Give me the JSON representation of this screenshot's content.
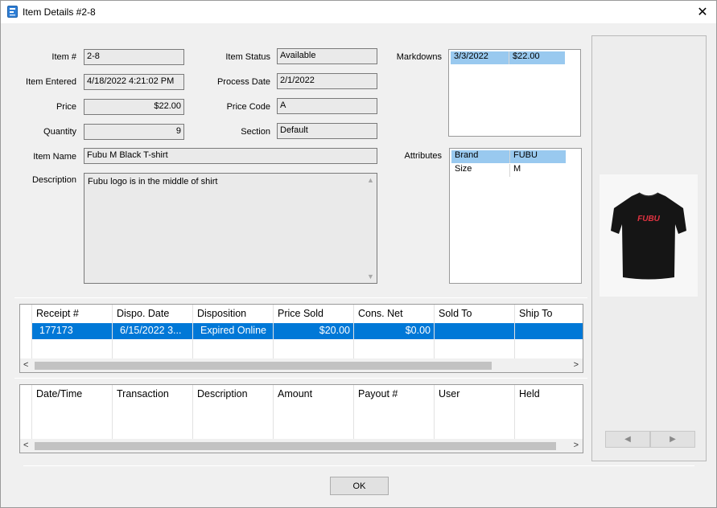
{
  "window": {
    "title": "Item Details #2-8",
    "close_label": "✕"
  },
  "item": {
    "labels": {
      "item_no": "Item #",
      "item_entered": "Item Entered",
      "price": "Price",
      "quantity": "Quantity",
      "item_status": "Item Status",
      "process_date": "Process Date",
      "price_code": "Price Code",
      "section": "Section",
      "item_name": "Item Name",
      "description": "Description",
      "markdowns": "Markdowns",
      "attributes": "Attributes"
    },
    "values": {
      "item_no": "2-8",
      "item_entered": "4/18/2022 4:21:02 PM",
      "price": "$22.00",
      "quantity": "9",
      "item_status": "Available",
      "process_date": "2/1/2022",
      "price_code": "A",
      "section": "Default",
      "item_name": "Fubu M Black T-shirt",
      "description": "Fubu logo is in the middle of shirt"
    }
  },
  "markdowns": [
    {
      "date": "3/3/2022",
      "price": "$22.00"
    }
  ],
  "attributes": [
    {
      "name": "Brand",
      "value": "FUBU"
    },
    {
      "name": "Size",
      "value": "M"
    }
  ],
  "sales_grid": {
    "columns": [
      "Receipt #",
      "Dispo. Date",
      "Disposition",
      "Price Sold",
      "Cons. Net",
      "Sold To",
      "Ship To"
    ],
    "rows": [
      {
        "receipt": "177173",
        "dispo_date": "6/15/2022 3...",
        "disposition": "Expired Online",
        "price_sold": "$20.00",
        "cons_net": "$0.00",
        "sold_to": "",
        "ship_to": ""
      }
    ]
  },
  "payout_grid": {
    "columns": [
      "Date/Time",
      "Transaction",
      "Description",
      "Amount",
      "Payout #",
      "User",
      "Held"
    ]
  },
  "image": {
    "logo_text": "FUBU",
    "shirt_color": "#151515",
    "logo_color": "#e03341",
    "prev_icon": "◀",
    "next_icon": "▶"
  },
  "buttons": {
    "ok": "OK"
  },
  "colors": {
    "selection": "#0078d7",
    "list_selection": "#99c9ef"
  }
}
